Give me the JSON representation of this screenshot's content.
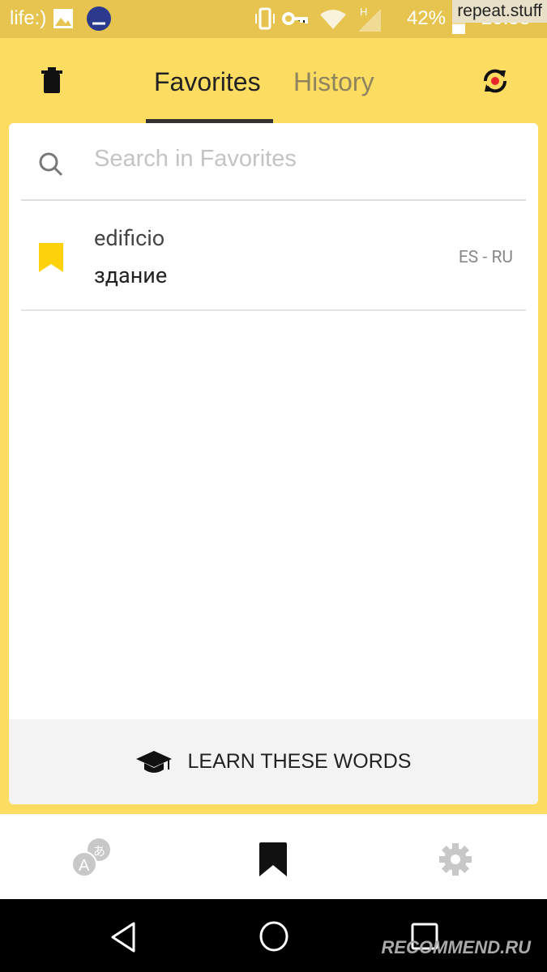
{
  "status_bar": {
    "carrier": "life:)",
    "battery": "42%",
    "time": "20:58",
    "watermark": "repeat.stuff"
  },
  "header": {
    "tabs": [
      {
        "label": "Favorites",
        "active": true
      },
      {
        "label": "History",
        "active": false
      }
    ],
    "delete_icon": "trash-icon",
    "sync_icon": "sync-icon"
  },
  "search": {
    "placeholder": "Search in Favorites",
    "value": ""
  },
  "favorites": [
    {
      "word": "edificio",
      "translation": "здание",
      "langs": "ES - RU"
    }
  ],
  "learn_button": "LEARN THESE WORDS",
  "bottom_nav": [
    {
      "icon": "translate-icon",
      "active": false
    },
    {
      "icon": "bookmark-icon",
      "active": true
    },
    {
      "icon": "settings-icon",
      "active": false
    }
  ],
  "footer_watermark": "RECOMMEND.RU",
  "colors": {
    "accent": "#fddc62",
    "status_bar": "#e6c44f",
    "bookmark": "#fdd20a"
  }
}
